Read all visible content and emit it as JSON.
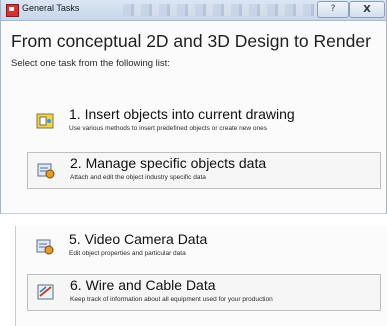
{
  "window": {
    "title": "General Tasks",
    "help_glyph": "?",
    "close_glyph": "X"
  },
  "heading": "From conceptual 2D and 3D Design to Render",
  "subheading": "Select one task from the following list:",
  "tasks_top": [
    {
      "title": "1. Insert objects into current drawing",
      "desc": "Use various methods to insert predefined objects or create new ones",
      "icon": "insert-objects-icon"
    },
    {
      "title": "2. Manage specific objects data",
      "desc": "Attach and edit the object industry specific data",
      "icon": "manage-data-icon"
    }
  ],
  "tasks_bottom": [
    {
      "title": "5. Video Camera Data",
      "desc": "Edit object properties and particular data",
      "icon": "video-camera-data-icon"
    },
    {
      "title": "6. Wire and Cable Data",
      "desc": "Keep track of information about all equipment used for your production",
      "icon": "wire-cable-data-icon"
    }
  ]
}
